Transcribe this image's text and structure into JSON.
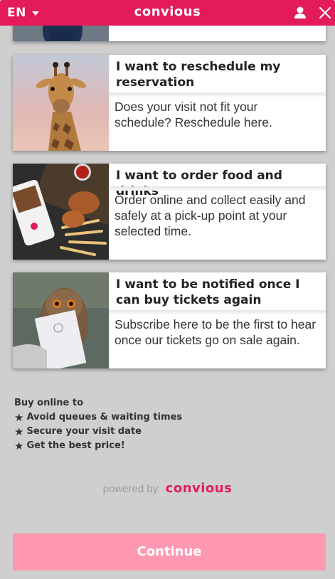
{
  "header": {
    "language": "EN",
    "brand": "convious"
  },
  "cards": [
    {
      "title": "",
      "description": ""
    },
    {
      "title": "I want to reschedule my reservation",
      "description": "Does your visit not fit your schedule? Reschedule here."
    },
    {
      "title": "I want to order food and drinks",
      "description": "Order online and collect easily and safely at a pick-up point at your selected time."
    },
    {
      "title": "I want to be notified once I can buy tickets again",
      "description": "Subscribe here to be the first to hear once our tickets go on sale again."
    }
  ],
  "perks": {
    "heading": "Buy online to",
    "items": [
      "Avoid queues & waiting times",
      "Secure your visit date",
      "Get the best price!"
    ],
    "star": "★"
  },
  "footer": {
    "powered_by": "powered by",
    "brand": "convious"
  },
  "continue_label": "Continue",
  "colors": {
    "brand": "#e31b5a",
    "continue": "#ff98b1",
    "background": "#cfcfcf"
  },
  "icons": [
    "chevron-down-icon",
    "user-icon",
    "close-icon",
    "star-icon"
  ]
}
